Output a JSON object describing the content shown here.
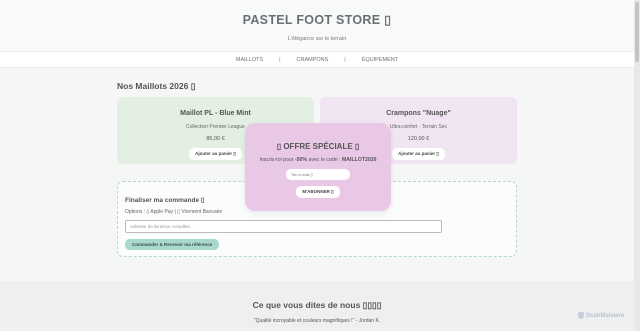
{
  "header": {
    "title": "PASTEL FOOT STORE ▯",
    "subtitle": "L'élégance sur le terrain"
  },
  "nav": {
    "items": [
      "MAILLOTS",
      "CRAMPONS",
      "ÉQUIPEMENT"
    ],
    "separator": "|"
  },
  "products": {
    "section_title": "Nos Maillots 2026 ▯",
    "cards": [
      {
        "title": "Maillot PL - Blue Mint",
        "subtitle": "Collection Premier League",
        "price": "85,00 €",
        "button": "Ajouter au panier ▯"
      },
      {
        "title": "Crampons \"Nuage\"",
        "subtitle": "Ultra-confort - Terrain Sec",
        "price": "120,00 €",
        "button": "Ajouter au panier ▯"
      }
    ]
  },
  "order": {
    "title": "Finaliser ma commande ▯",
    "options": "Options : ▯ Apple Pay | ▯ Virement Bancaire",
    "address_placeholder": "Adresse de livraison complète...",
    "submit": "Commander & Recevoir ma référence"
  },
  "popup": {
    "title": "▯ OFFRE SPÉCIALE ▯",
    "text_prefix": "Inscris-toi pour ",
    "discount": "-50%",
    "text_middle": " avec le code : ",
    "code": "MAILLOT2026",
    "email_placeholder": "Ton e-mail ▯",
    "button": "M'ABONNER ▯"
  },
  "testimonials": {
    "title": "Ce que vous dites de nous ▯▯▯▯",
    "quote": "\"Qualité incroyable et couleurs magnifiques !\" - Jordan K."
  },
  "watermark": {
    "label": "ScanMalware"
  },
  "colors": {
    "card_green": "#e3efe3",
    "card_purple": "#f1e5f3",
    "popup": "#e9c8e6",
    "primary_button": "#a9d8cc",
    "dashed_border": "#b6d7cf"
  }
}
